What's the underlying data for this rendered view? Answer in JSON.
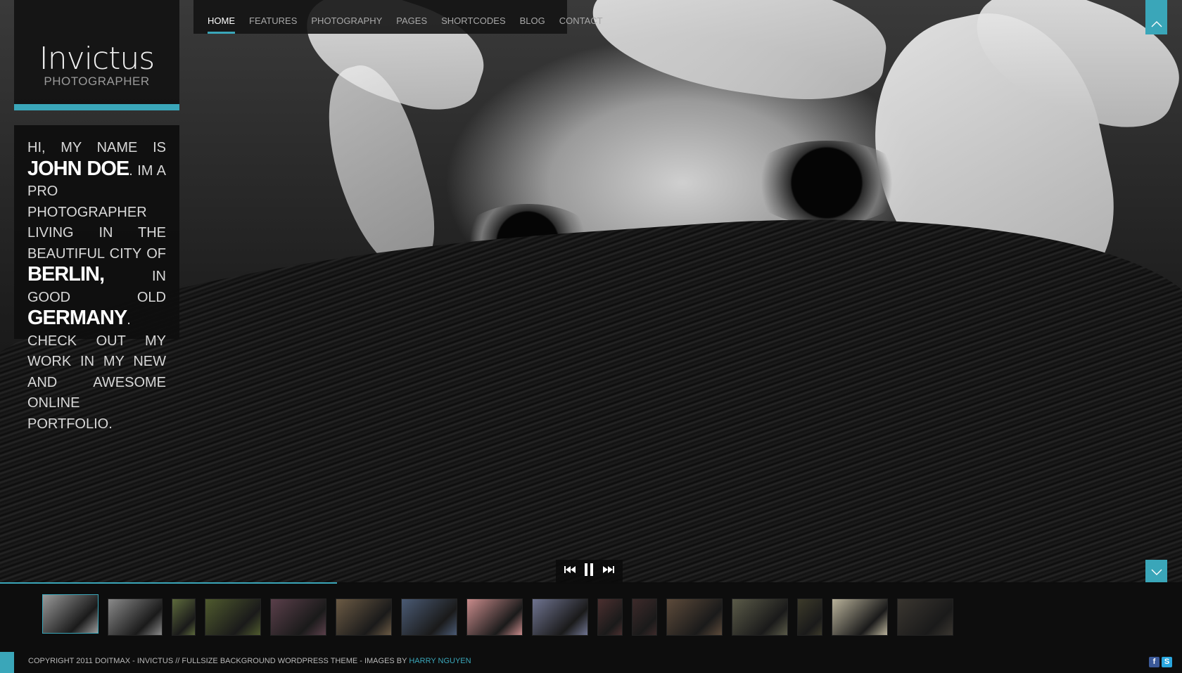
{
  "logo": {
    "title": "Invictus",
    "subtitle": "PHOTOGRAPHER"
  },
  "intro": {
    "parts": [
      {
        "text": "Hi, my name is ",
        "strong": false
      },
      {
        "text": "JOHN DOE",
        "strong": true
      },
      {
        "text": ". Im a pro photographer living in the beautiful city of ",
        "strong": false
      },
      {
        "text": "BERLIN,",
        "strong": true
      },
      {
        "text": " in good old ",
        "strong": false
      },
      {
        "text": "GERMANY",
        "strong": true
      },
      {
        "text": ". Check out my work in my new and awesome online portfolio.",
        "strong": false
      }
    ]
  },
  "nav": {
    "items": [
      "HOME",
      "FEATURES",
      "PHOTOGRAPHY",
      "PAGES",
      "SHORTCODES",
      "BLOG",
      "CONTACT"
    ],
    "active_index": 0
  },
  "slideshow": {
    "progress_fraction": 0.285,
    "thumbnail_count": 16,
    "active_thumbnail": 0,
    "controls": [
      "previous-icon",
      "pause-icon",
      "next-icon"
    ]
  },
  "footer": {
    "copyright": "COPYRIGHT 2011 DOITMAX - INVICTUS // FULLSIZE BACKGROUND WORDPRESS THEME - IMAGES BY ",
    "credit_link": "HARRY NGUYEN",
    "social": [
      "facebook-icon",
      "skype-icon"
    ]
  },
  "colors": {
    "accent": "#3aa6b9",
    "panel": "#121212",
    "text": "#d8d8d8"
  }
}
